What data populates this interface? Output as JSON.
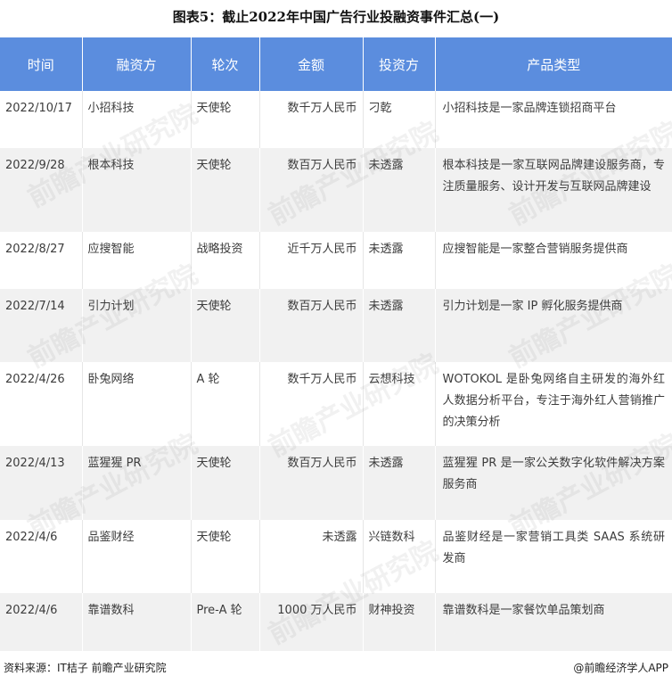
{
  "title": "图表5：截止2022年中国广告行业投融资事件汇总(一)",
  "table": {
    "headers": [
      "时间",
      "融资方",
      "轮次",
      "金额",
      "投资方",
      "产品类型"
    ],
    "rows": [
      [
        "2022/10/17",
        "小招科技",
        "天使轮",
        "数千万人民币",
        "刁乾",
        "小招科技是一家品牌连锁招商平台"
      ],
      [
        "2022/9/28",
        "根本科技",
        "天使轮",
        "数百万人民币",
        "未透露",
        "根本科技是一家互联网品牌建设服务商，专注质量服务、设计开发与互联网品牌建设"
      ],
      [
        "2022/8/27",
        "应搜智能",
        "战略投资",
        "近千万人民币",
        "未透露",
        "应搜智能是一家整合营销服务提供商"
      ],
      [
        "2022/7/14",
        "引力计划",
        "天使轮",
        "数百万人民币",
        "未透露",
        "引力计划是一家 IP 孵化服务提供商"
      ],
      [
        "2022/4/26",
        "卧兔网络",
        "A 轮",
        "数千万人民币",
        "云想科技",
        "WOTOKOL 是卧兔网络自主研发的海外红人数据分析平台，专注于海外红人营销推广的决策分析"
      ],
      [
        "2022/4/13",
        "蓝猩猩 PR",
        "天使轮",
        "数百万人民币",
        "未透露",
        "蓝猩猩 PR 是一家公关数字化软件解决方案服务商"
      ],
      [
        "2022/4/6",
        "品鉴财经",
        "天使轮",
        "未透露",
        "兴链数科",
        "品鉴财经是一家营销工具类 SAAS 系统研发商"
      ],
      [
        "2022/4/6",
        "靠谱数科",
        "Pre-A 轮",
        "1000 万人民币",
        "财神投资",
        "靠谱数科是一家餐饮单品策划商"
      ]
    ]
  },
  "watermark": "前瞻产业研究院",
  "footer": {
    "source": "资料来源：IT桔子 前瞻产业研究院",
    "brand": "@前瞻经济学人APP"
  }
}
